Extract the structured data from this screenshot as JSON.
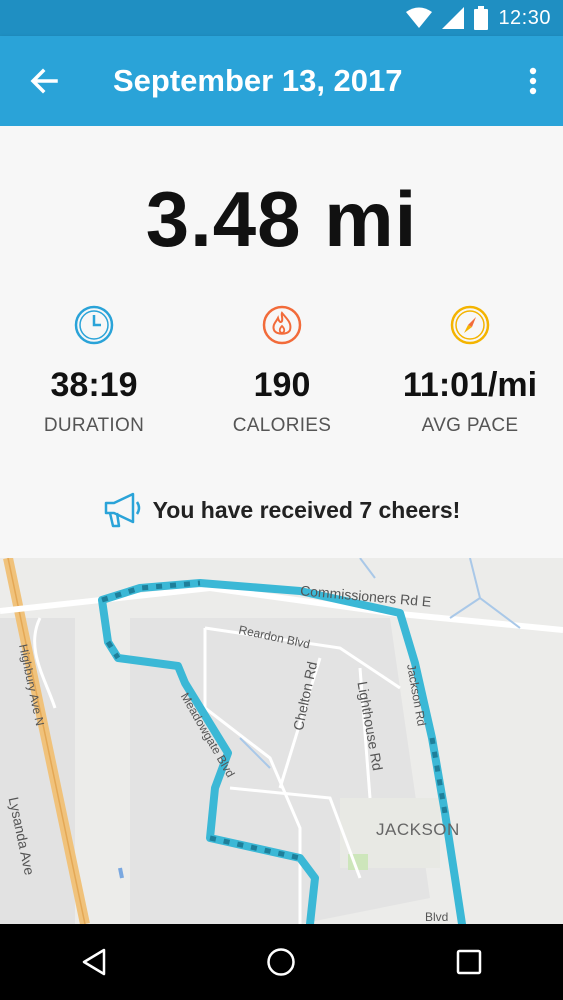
{
  "status_bar": {
    "time": "12:30"
  },
  "header": {
    "title": "September 13, 2017"
  },
  "summary": {
    "distance": "3.48 mi"
  },
  "stats": {
    "duration": {
      "value": "38:19",
      "label": "DURATION",
      "icon": "clock-icon"
    },
    "calories": {
      "value": "190",
      "label": "CALORIES",
      "icon": "flame-icon"
    },
    "pace": {
      "value": "11:01/mi",
      "label": "AVG PACE",
      "icon": "compass-icon"
    }
  },
  "cheers": {
    "text": "You have received 7 cheers!",
    "icon": "megaphone-icon"
  },
  "map": {
    "labels": {
      "commissioners": "Commissioners Rd E",
      "reardon": "Reardon Blvd",
      "chelton": "Chelton Rd",
      "lighthouse": "Lighthouse Rd",
      "jackson_rd": "Jackson Rd",
      "meadowgate": "Meadowgate Blvd",
      "highbury": "Highbury Ave N",
      "lysanda": "Lysanda Ave",
      "jackson_area": "JACKSON",
      "blvd": "Blvd"
    }
  },
  "colors": {
    "appbar": "#2aa3d8",
    "statusbar": "#1f8fc2",
    "route": "#3bb8d6",
    "duration_icon": "#2aa3d8",
    "calories_icon": "#f26b3a",
    "pace_icon": "#f4b400"
  }
}
